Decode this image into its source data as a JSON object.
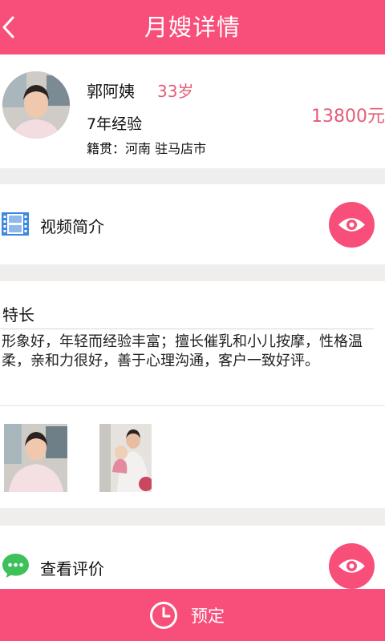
{
  "header": {
    "title": "月嫂详情",
    "back_icon": "chevron-left-icon"
  },
  "profile": {
    "name": "郭阿姨",
    "age": "33岁",
    "experience": "7年经验",
    "hometown": "籍贯：河南 驻马店市",
    "price": "13800元"
  },
  "video": {
    "label": "视频简介",
    "icon": "film-icon",
    "action_icon": "eye-icon"
  },
  "specialty": {
    "title": "特长",
    "description": "形象好，年轻而经验丰富；擅长催乳和小儿按摩，性格温柔，亲和力很好，善于心理沟通，客户一致好评。"
  },
  "reviews": {
    "label": "查看评价",
    "icon": "chat-bubble-icon",
    "action_icon": "eye-icon"
  },
  "footer": {
    "book_label": "预定",
    "icon": "clock-icon"
  },
  "colors": {
    "accent": "#f74f79",
    "price": "#e55c79",
    "background": "#f0eded",
    "chat_green": "#3ec05b",
    "film_blue": "#3f86e0"
  }
}
